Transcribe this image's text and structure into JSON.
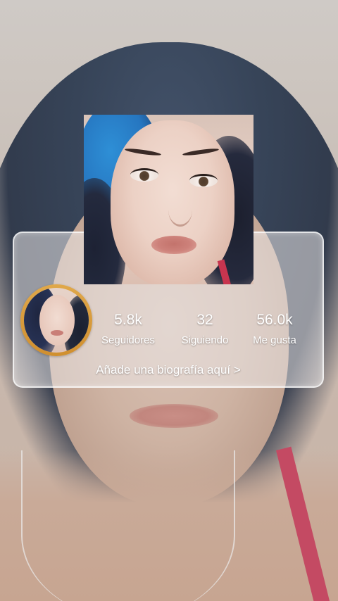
{
  "profile": {
    "stats": [
      {
        "value": "5.8k",
        "label": "Seguidores"
      },
      {
        "value": "32",
        "label": "Siguiendo"
      },
      {
        "value": "56.0k",
        "label": "Me gusta"
      }
    ],
    "bio_prompt": "Añade una biografía aquí >"
  },
  "colors": {
    "avatar_ring": "#d9982f",
    "text": "#ffffff",
    "panel_bg": "rgba(235,232,232,0.55)"
  }
}
